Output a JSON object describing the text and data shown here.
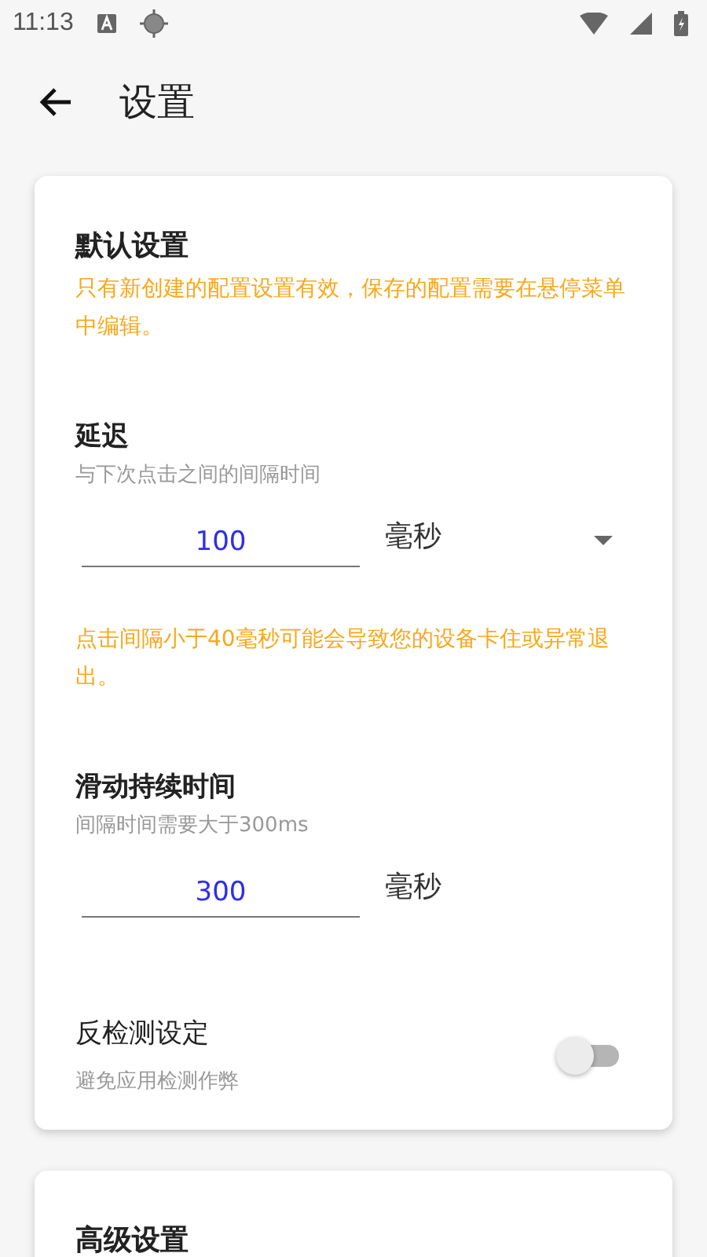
{
  "status_bar": {
    "time": "11:13"
  },
  "app_bar": {
    "title": "设置"
  },
  "sections": [
    {
      "title": "默认设置",
      "items": [
        {
          "kind": "note",
          "text": "只有新创建的配置设置有效，保存的配置需要在悬停菜单中编辑。"
        },
        {
          "kind": "number",
          "title": "延迟",
          "subtitle": "与下次点击之间的间隔时间",
          "value": "100",
          "unit": "毫秒",
          "dropdown": true
        },
        {
          "kind": "note",
          "text": "点击间隔小于40毫秒可能会导致您的设备卡住或异常退出。"
        },
        {
          "kind": "number",
          "title": "滑动持续时间",
          "subtitle": "间隔时间需要大于300ms",
          "value": "300",
          "unit": "毫秒",
          "dropdown": false
        },
        {
          "kind": "switch",
          "title": "反检测设定",
          "subtitle": "避免应用检测作弊",
          "on": false
        }
      ]
    },
    {
      "title": "高级设置"
    }
  ]
}
